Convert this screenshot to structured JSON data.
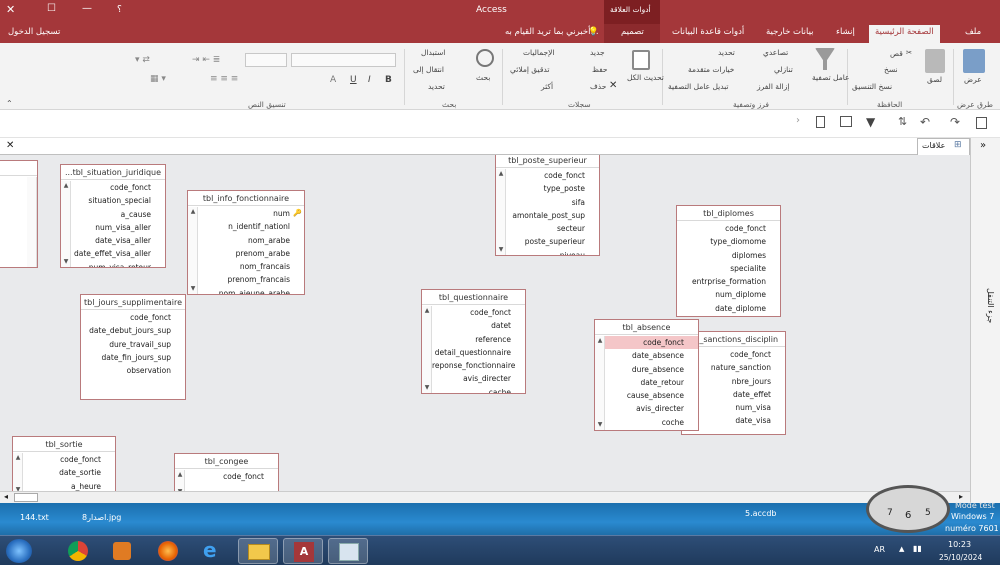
{
  "titlebar": {
    "app": "Access",
    "context_group": "أدوات العلاقة",
    "search": "أخبرني بما تريد القيام به...",
    "signin": "تسجيل الدخول",
    "help_icon": "؟"
  },
  "tabs": {
    "file": "ملف",
    "home": "الصفحة الرئيسية",
    "create": "إنشاء",
    "external": "بيانات خارجية",
    "dbtools": "أدوات قاعدة البيانات",
    "design": "تصميم"
  },
  "ribbon": {
    "views": {
      "view": "عرض",
      "group": "طرق عرض"
    },
    "clipboard": {
      "paste": "لصق",
      "cut": "قص",
      "copy": "نسخ",
      "format_painter": "نسخ التنسيق",
      "group": "الحافظة"
    },
    "sort": {
      "filter": "عامل تصفية",
      "asc": "تصاعدي",
      "desc": "تنازلي",
      "remove_sort": "إزالة الفرز",
      "selection": "تحديد",
      "advanced": "خيارات متقدمة",
      "toggle": "تبديل عامل التصفية",
      "group": "فرز وتصفية"
    },
    "records": {
      "refresh": "تحديث الكل",
      "new": "جديد",
      "save": "حفظ",
      "delete": "حذف",
      "totals": "الإجماليات",
      "spelling": "تدقيق إملائي",
      "more": "أكثر",
      "group": "سجلات"
    },
    "find": {
      "find": "بحث",
      "replace": "استبدال",
      "goto": "انتقال إلى",
      "select": "تحديد",
      "group": "بحث"
    },
    "text": {
      "bold": "B",
      "italic": "I",
      "underline": "U",
      "fontcolor": "A",
      "group": "تنسيق النص"
    }
  },
  "document": {
    "tab_label": "علاقات",
    "nav_pane": "جزء التنقل"
  },
  "tables": [
    {
      "name": "...tbl_situation_juridique",
      "fields": [
        "code_fonct",
        "situation_special",
        "a_cause",
        "num_visa_aller",
        "date_visa_aller",
        "date_effet_visa_aller",
        "num_visa_retour"
      ]
    },
    {
      "name": "tbl_info_fonctionnaire",
      "fields": [
        "num",
        "n_identif_nationl",
        "nom_arabe",
        "prenom_arabe",
        "nom_francais",
        "prenom_francais",
        "nom_ajeune_arabe"
      ]
    },
    {
      "name": "tbl_poste_superieur",
      "fields": [
        "code_fonct",
        "type_poste",
        "sifa",
        "amontale_post_sup",
        "secteur",
        "poste_superieur",
        "niveau"
      ]
    },
    {
      "name": "tbl_diplomes",
      "fields": [
        "code_fonct",
        "type_diomome",
        "diplomes",
        "specialite",
        "entrprise_formation",
        "num_diplome",
        "date_diplome"
      ]
    },
    {
      "name": "tbl_jours_supplimentaire",
      "fields": [
        "code_fonct",
        "date_debut_jours_sup",
        "dure_travail_sup",
        "date_fin_jours_sup",
        "observation"
      ]
    },
    {
      "name": "tbl_questionnaire",
      "fields": [
        "code_fonct",
        "datet",
        "reference",
        "detail_questionnaire",
        "reponse_fonctionnaire",
        "avis_directer",
        "cache"
      ]
    },
    {
      "name": "tbl_absence",
      "fields": [
        "code_fonct",
        "date_absence",
        "dure_absence",
        "date_retour",
        "cause_absence",
        "avis_directer",
        "coche"
      ]
    },
    {
      "name": "tbl_sanctions_disciplin",
      "fields": [
        "code_fonct",
        "nature_sanction",
        "nbre_jours",
        "date_effet",
        "num_visa",
        "date_visa"
      ]
    },
    {
      "name": "tbl_sortie",
      "fields": [
        "code_fonct",
        "date_sortie",
        "a_heure"
      ]
    },
    {
      "name": "tbl_congee",
      "fields": [
        "code_fonct"
      ]
    }
  ],
  "desktop": {
    "file1": "144.txt",
    "file2": "اصدار8.jpg",
    "file3": "5.accdb",
    "watermark1": "Mode test",
    "watermark2": "Windows 7",
    "watermark3": "numéro 7601"
  },
  "taskbar": {
    "lang": "AR",
    "time": "10:23",
    "date": "25/10/2024"
  }
}
